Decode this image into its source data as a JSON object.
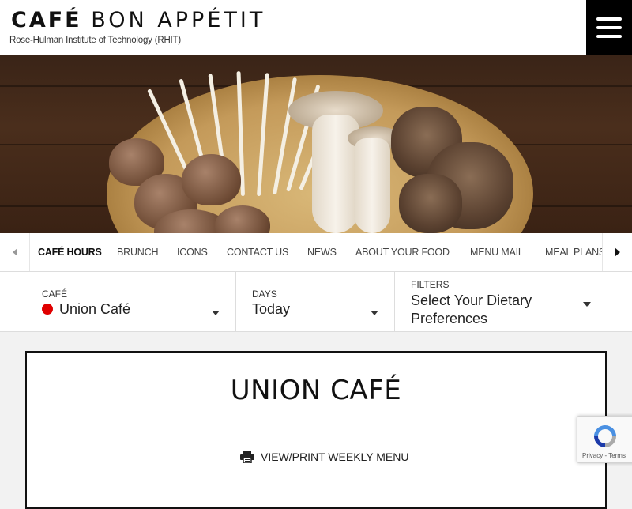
{
  "header": {
    "logo_bold": "CAFÉ",
    "logo_thin": "BON APPÉTIT",
    "subtitle": "Rose-Hulman Institute of Technology (RHIT)"
  },
  "nav": {
    "items": [
      {
        "label": "Café Hours",
        "active": true
      },
      {
        "label": "Brunch"
      },
      {
        "label": "Icons"
      },
      {
        "label": "Contact Us"
      },
      {
        "label": "News"
      },
      {
        "label": "About Your Food"
      },
      {
        "label": "Menu Mail"
      },
      {
        "label": "Meal Plans"
      }
    ]
  },
  "selectors": {
    "cafe": {
      "label": "Café",
      "value": "Union Café",
      "status_color": "#e00000"
    },
    "days": {
      "label": "Days",
      "value": "Today"
    },
    "filters": {
      "label": "Filters",
      "value": "Select Your Dietary Preferences"
    }
  },
  "main": {
    "title": "UNION CAFÉ",
    "print_link": "View/Print Weekly Menu"
  },
  "recaptcha": {
    "links": "Privacy - Terms"
  },
  "colors": {
    "accent": "#000000",
    "status_dot": "#e00000"
  }
}
